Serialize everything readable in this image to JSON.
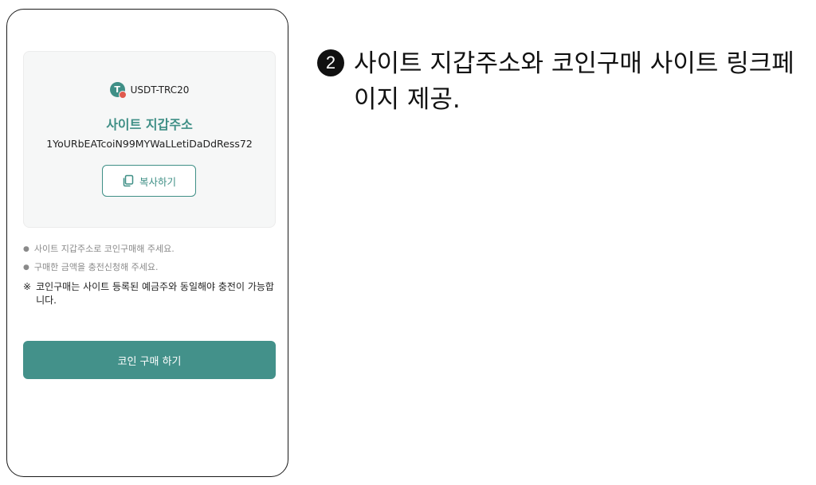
{
  "wallet": {
    "coin_icon": "tether-icon",
    "coin_icon_letter": "T",
    "coin_name": "USDT-TRC20",
    "title": "사이트 지갑주소",
    "address": "1YoURbEATcoiN99MYWaLLetiDaDdRess72",
    "copy_icon": "copy-icon",
    "copy_label": "복사하기"
  },
  "notes": {
    "items": [
      "사이트 지갑주소로 코인구매해 주세요.",
      "구매한 금액을 충전신청해 주세요."
    ],
    "warning_mark": "※",
    "warning": "코인구매는 사이트 등록된 예금주와 동일해야 충전이 가능합니다."
  },
  "buy_button": {
    "label": "코인 구매 하기"
  },
  "annotation": {
    "step": "2",
    "text": "사이트 지갑주소와 코인구매 사이트 링크페이지 제공."
  },
  "colors": {
    "accent": "#3f8f86",
    "button": "#43918a",
    "warning_dot": "#e05a4e"
  }
}
